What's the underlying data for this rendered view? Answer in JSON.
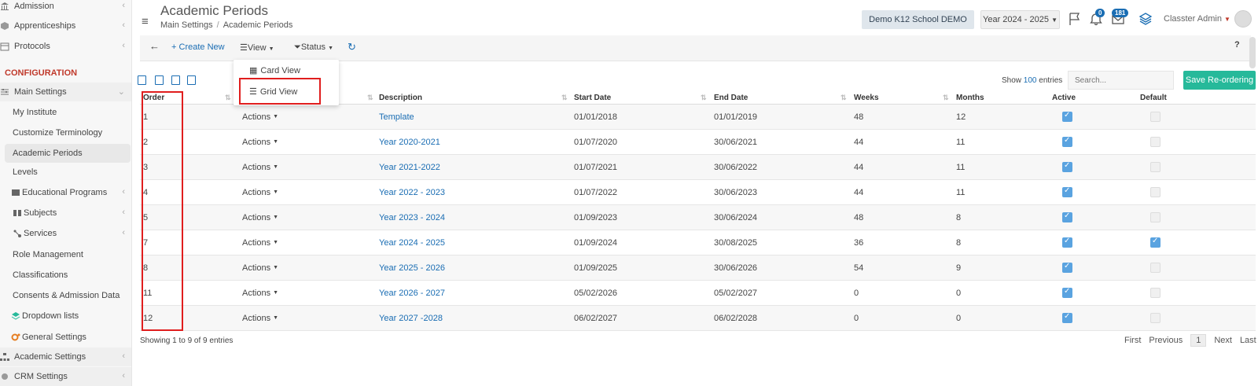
{
  "sidebar": {
    "admission": "Admission",
    "apprenticeships": "Apprenticeships",
    "protocols": "Protocols",
    "section": "CONFIGURATION",
    "main_settings": "Main Settings",
    "my_institute": "My Institute",
    "customize_terminology": "Customize Terminology",
    "academic_periods": "Academic Periods",
    "levels": "Levels",
    "educational_programs": "Educational Programs",
    "subjects": "Subjects",
    "services": "Services",
    "role_management": "Role Management",
    "classifications": "Classifications",
    "consents": "Consents & Admission Data",
    "dropdown_lists": "Dropdown lists",
    "general_settings": "General Settings",
    "academic_settings": "Academic Settings",
    "crm_settings": "CRM Settings"
  },
  "header": {
    "title": "Academic Periods",
    "breadcrumb": [
      "Main Settings",
      "Academic Periods"
    ],
    "school": "Demo K12 School DEMO",
    "year": "Year 2024 - 2025",
    "notif_count": "0",
    "msg_count": "181",
    "user": "Classter Admin"
  },
  "toolbar": {
    "create": "Create New",
    "view": "View",
    "status": "Status",
    "help": "?"
  },
  "view_menu": {
    "card": "Card View",
    "grid": "Grid View"
  },
  "controls": {
    "show": "Show",
    "entries_count": "100",
    "entries": "entries",
    "search_placeholder": "Search...",
    "save": "Save Re-ordering"
  },
  "table": {
    "headers": {
      "order": "Order",
      "description": "Description",
      "start": "Start Date",
      "end": "End Date",
      "weeks": "Weeks",
      "months": "Months",
      "active": "Active",
      "default": "Default"
    },
    "actions_label": "Actions",
    "rows": [
      {
        "order": "1",
        "description": "Template",
        "start": "01/01/2018",
        "end": "01/01/2019",
        "weeks": "48",
        "months": "12",
        "active": true,
        "default": false
      },
      {
        "order": "2",
        "description": "Year 2020-2021",
        "start": "01/07/2020",
        "end": "30/06/2021",
        "weeks": "44",
        "months": "11",
        "active": true,
        "default": false
      },
      {
        "order": "3",
        "description": "Year 2021-2022",
        "start": "01/07/2021",
        "end": "30/06/2022",
        "weeks": "44",
        "months": "11",
        "active": true,
        "default": false
      },
      {
        "order": "4",
        "description": "Year 2022 - 2023",
        "start": "01/07/2022",
        "end": "30/06/2023",
        "weeks": "44",
        "months": "11",
        "active": true,
        "default": false
      },
      {
        "order": "5",
        "description": "Year 2023 - 2024",
        "start": "01/09/2023",
        "end": "30/06/2024",
        "weeks": "48",
        "months": "8",
        "active": true,
        "default": false
      },
      {
        "order": "7",
        "description": "Year 2024 - 2025",
        "start": "01/09/2024",
        "end": "30/08/2025",
        "weeks": "36",
        "months": "8",
        "active": true,
        "default": true
      },
      {
        "order": "8",
        "description": "Year 2025 - 2026",
        "start": "01/09/2025",
        "end": "30/06/2026",
        "weeks": "54",
        "months": "9",
        "active": true,
        "default": false
      },
      {
        "order": "11",
        "description": "Year 2026 - 2027",
        "start": "05/02/2026",
        "end": "05/02/2027",
        "weeks": "0",
        "months": "0",
        "active": true,
        "default": false
      },
      {
        "order": "12",
        "description": "Year 2027 -2028",
        "start": "06/02/2027",
        "end": "06/02/2028",
        "weeks": "0",
        "months": "0",
        "active": true,
        "default": false
      }
    ]
  },
  "footer": {
    "info": "Showing 1 to 9 of 9 entries",
    "first": "First",
    "previous": "Previous",
    "page": "1",
    "next": "Next",
    "last": "Last"
  },
  "colors": {
    "accent": "#1a6db3",
    "save": "#26b99a",
    "highlight": "#e01e1e",
    "section": "#c0392b"
  }
}
